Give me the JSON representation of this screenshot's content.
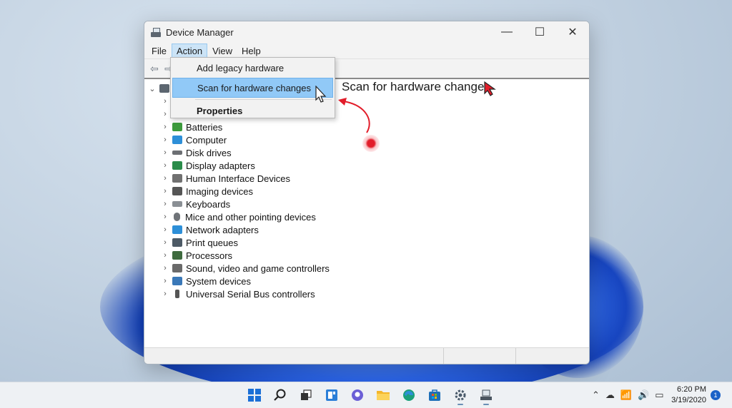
{
  "window": {
    "title": "Device Manager",
    "controls": {
      "minimize": "—",
      "maximize": "☐",
      "close": "✕"
    }
  },
  "menubar": {
    "items": [
      "File",
      "Action",
      "View",
      "Help"
    ],
    "active": "Action"
  },
  "toolbar": {
    "back_icon": "⇦",
    "forward_icon": "⇨"
  },
  "tree": {
    "root_chevron": "⌄",
    "child_chevron": "›",
    "items": [
      {
        "label": "Batteries",
        "icon": "battery-icon",
        "color": "#3c9a3c"
      },
      {
        "label": "Computer",
        "icon": "computer-icon",
        "color": "#2d8fd8"
      },
      {
        "label": "Disk drives",
        "icon": "disk-drive-icon",
        "color": "#6c6f73"
      },
      {
        "label": "Display adapters",
        "icon": "display-adapter-icon",
        "color": "#2a8c4a"
      },
      {
        "label": "Human Interface Devices",
        "icon": "hid-icon",
        "color": "#707070"
      },
      {
        "label": "Imaging devices",
        "icon": "camera-icon",
        "color": "#555555"
      },
      {
        "label": "Keyboards",
        "icon": "keyboard-icon",
        "color": "#8a8f94"
      },
      {
        "label": "Mice and other pointing devices",
        "icon": "mouse-icon",
        "color": "#6f7378"
      },
      {
        "label": "Network adapters",
        "icon": "network-adapter-icon",
        "color": "#2d8fd8"
      },
      {
        "label": "Print queues",
        "icon": "printer-icon",
        "color": "#4d5a66"
      },
      {
        "label": "Processors",
        "icon": "processor-icon",
        "color": "#3f6b3f"
      },
      {
        "label": "Sound, video and game controllers",
        "icon": "speaker-icon",
        "color": "#6a6a6a"
      },
      {
        "label": "System devices",
        "icon": "system-devices-icon",
        "color": "#3a78b8"
      },
      {
        "label": "Universal Serial Bus controllers",
        "icon": "usb-icon",
        "color": "#555555"
      }
    ]
  },
  "dropdown": {
    "items": [
      {
        "label": "Add legacy hardware"
      },
      {
        "label": "Scan for hardware changes"
      },
      {
        "label": "Properties"
      }
    ]
  },
  "annotation": {
    "text": "Scan for hardware changes"
  },
  "taskbar": {
    "apps": [
      "start",
      "search",
      "task-view",
      "widgets",
      "chat",
      "file-explorer",
      "edge",
      "store",
      "settings",
      "device-manager"
    ],
    "clock_time": "6:20 PM",
    "clock_date": "3/19/2020",
    "notification_count": "1"
  },
  "colors": {
    "accent": "#1a62c7",
    "menu_highlight": "#91c9f7",
    "annotation_red": "#e21d2a"
  }
}
